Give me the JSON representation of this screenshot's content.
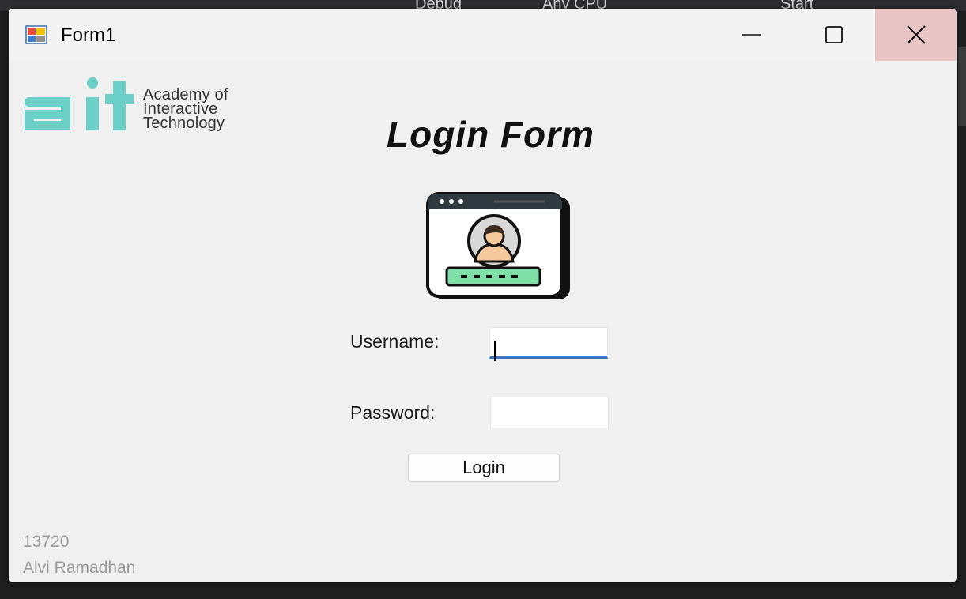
{
  "window": {
    "title": "Form1"
  },
  "logo": {
    "line1": "Academy of",
    "line2": "Interactive",
    "line3": "Technology",
    "brand_color": "#6ccfc8"
  },
  "form": {
    "heading": "Login Form",
    "username_label": "Username:",
    "password_label": "Password:",
    "username_value": "",
    "password_value": "",
    "login_label": "Login",
    "focus_color": "#3b74c4",
    "illustration_accent": "#7ee0a6"
  },
  "footer": {
    "id": "13720",
    "name": "Alvi Ramadhan"
  },
  "ide": {
    "config": "Debug",
    "platform": "Any CPU",
    "run_label": "Start"
  }
}
